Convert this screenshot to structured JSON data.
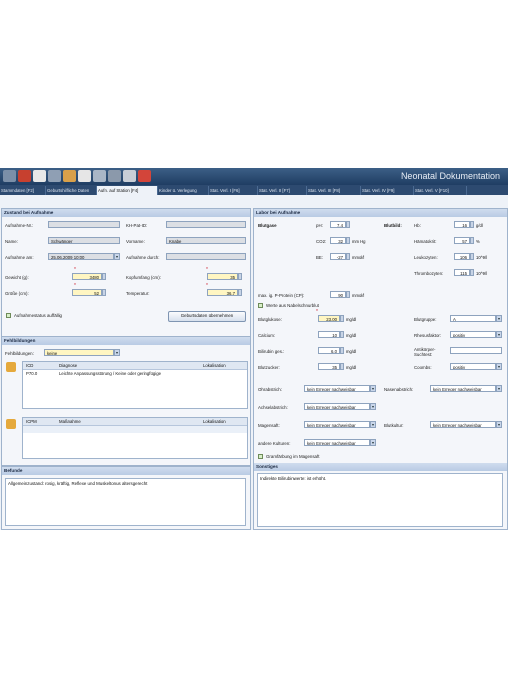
{
  "app": {
    "title": "Neonatal Dokumentation"
  },
  "tabs": [
    "Stammdaten [F2]",
    "Geburtshilfliche Daten",
    "Aufn. auf Station [F4]",
    "Kinder ü. Verlegung",
    "Stat. Verl. I [F6]",
    "Stat. Verl. II [F7]",
    "Stat. Verl. III [F8]",
    "Stat. Verl. IV [F9]",
    "Stat. Verl. V [F10]"
  ],
  "aufnahme": {
    "header": "Zustand bei Aufnahme",
    "aufnahme_nr_label": "Aufnahme-Nr.:",
    "aufnahme_nr": "",
    "kh_nr_label": "KH-Pat-ID:",
    "kh_nr": "",
    "name_label": "Name:",
    "name": "Schwänger",
    "vorname_label": "Vorname:",
    "vorname": "Knabe",
    "aufnahme_am_label": "Aufnahme am:",
    "aufnahme_am": "25.06.2009 10:00",
    "aufnahme_durch_label": "Aufnahme durch:",
    "aufnahme_durch": "",
    "gewicht_label": "Gewicht (g):",
    "gewicht": "3480",
    "kopfumfang_label": "Kopfumfang (cm):",
    "kopfumfang": "35",
    "groesse_label": "Größe (cm):",
    "groesse": "52",
    "temperatur_label": "Temperatur:",
    "temperatur": "36,7",
    "checkbox_label": "Aufnahmestatus auffällig",
    "button": "Geburtsdaten übernehmen"
  },
  "fehlbildungen": {
    "header": "Fehlbildungen",
    "filter_label": "Fehlbildungen:",
    "filter_value": "keine",
    "grid1_headers": [
      "ICD",
      "Diagnose",
      "Lokalisation"
    ],
    "grid1_rows": [
      [
        "P70.0",
        "Leichte Anpassungsstörung / Keine oder geringfügige",
        ""
      ]
    ],
    "grid2_headers": [
      "ICPM",
      "Maßnahme",
      "Lokalisation"
    ],
    "grid2_rows": []
  },
  "befund": {
    "header": "Befunde",
    "text": "Allgemeinzustand: rosig, kräftig, Reflexe und Muskeltonus altersgerecht"
  },
  "labor": {
    "header": "Labor bei Aufnahme",
    "blutgase_label": "Blutgase",
    "ph_label": "pH:",
    "ph": "7,4",
    "co2_label": "CO2:",
    "co2": "32",
    "co2_unit": "mm Hg",
    "be_label": "BE:",
    "be": "-27",
    "be_unit": "mmol/l",
    "blutbild_label": "Blutbild:",
    "hb_label": "Hb:",
    "hb": "16",
    "hb_unit": "g/dl",
    "hk_label": "Hämatokrit:",
    "hk": "57",
    "hk_unit": "%",
    "leuko_label": "Leukozyten:",
    "leuko": "106",
    "leuko_unit": "10^9/l",
    "thrombo_label": "Thrombozyten:",
    "thrombo": "115",
    "thrombo_unit": "10^9/l",
    "crp_label": "max. ig. P-Protein (CP):",
    "crp": "90",
    "crp_unit": "mmol/l",
    "wert_check": "Werte aus Nabelschnurblut",
    "glucose_label": "Blutglukose:",
    "glucose": "23,00",
    "glucose_unit": "mg/dl",
    "calcium_label": "Calcium:",
    "calcium": "10",
    "calcium_unit": "mg/dl",
    "bili_label": "Bilirubin ges.:",
    "bili": "6,0",
    "bili_unit": "mg/dl",
    "blutzucker_label": "Blutzucker:",
    "blutzucker": "35",
    "blutzucker_unit": "mg/dl",
    "blutgruppe_label": "Blutgruppe:",
    "blutgruppe": "A",
    "rhesus_label": "Rhesusfaktor:",
    "rhesus": "positiv",
    "antikoerper_label": "Antikörper-Suchtest:",
    "antikoerper": "",
    "coombs_label": "Coombs:",
    "coombs": "positiv",
    "ohrabstrich_label": "Ohrabstrich:",
    "ohrabstrich": "kein Erreger nachweisbar",
    "nasenabstrich_label": "Nasenabstrich:",
    "nasenabstrich": "kein Erreger nachweisbar",
    "achselabstrich_label": "Achselabstrich:",
    "achselabstrich": "kein Erreger nachweisbar",
    "magensaft_label": "Magensaft:",
    "magensaft": "kein Erreger nachweisbar",
    "andere_label": "andere Kulturen:",
    "andere": "kein Erreger nachweisbar",
    "blutkultur_label": "Blutkultur:",
    "blutkultur": "kein Erreger nachweisbar",
    "gramfaerbung": "Gramfärbung im Magensaft",
    "sonstiges_header": "Sonstiges",
    "sonstiges_text": "Indirekte Bilirubinwerte: ist erhöht."
  }
}
